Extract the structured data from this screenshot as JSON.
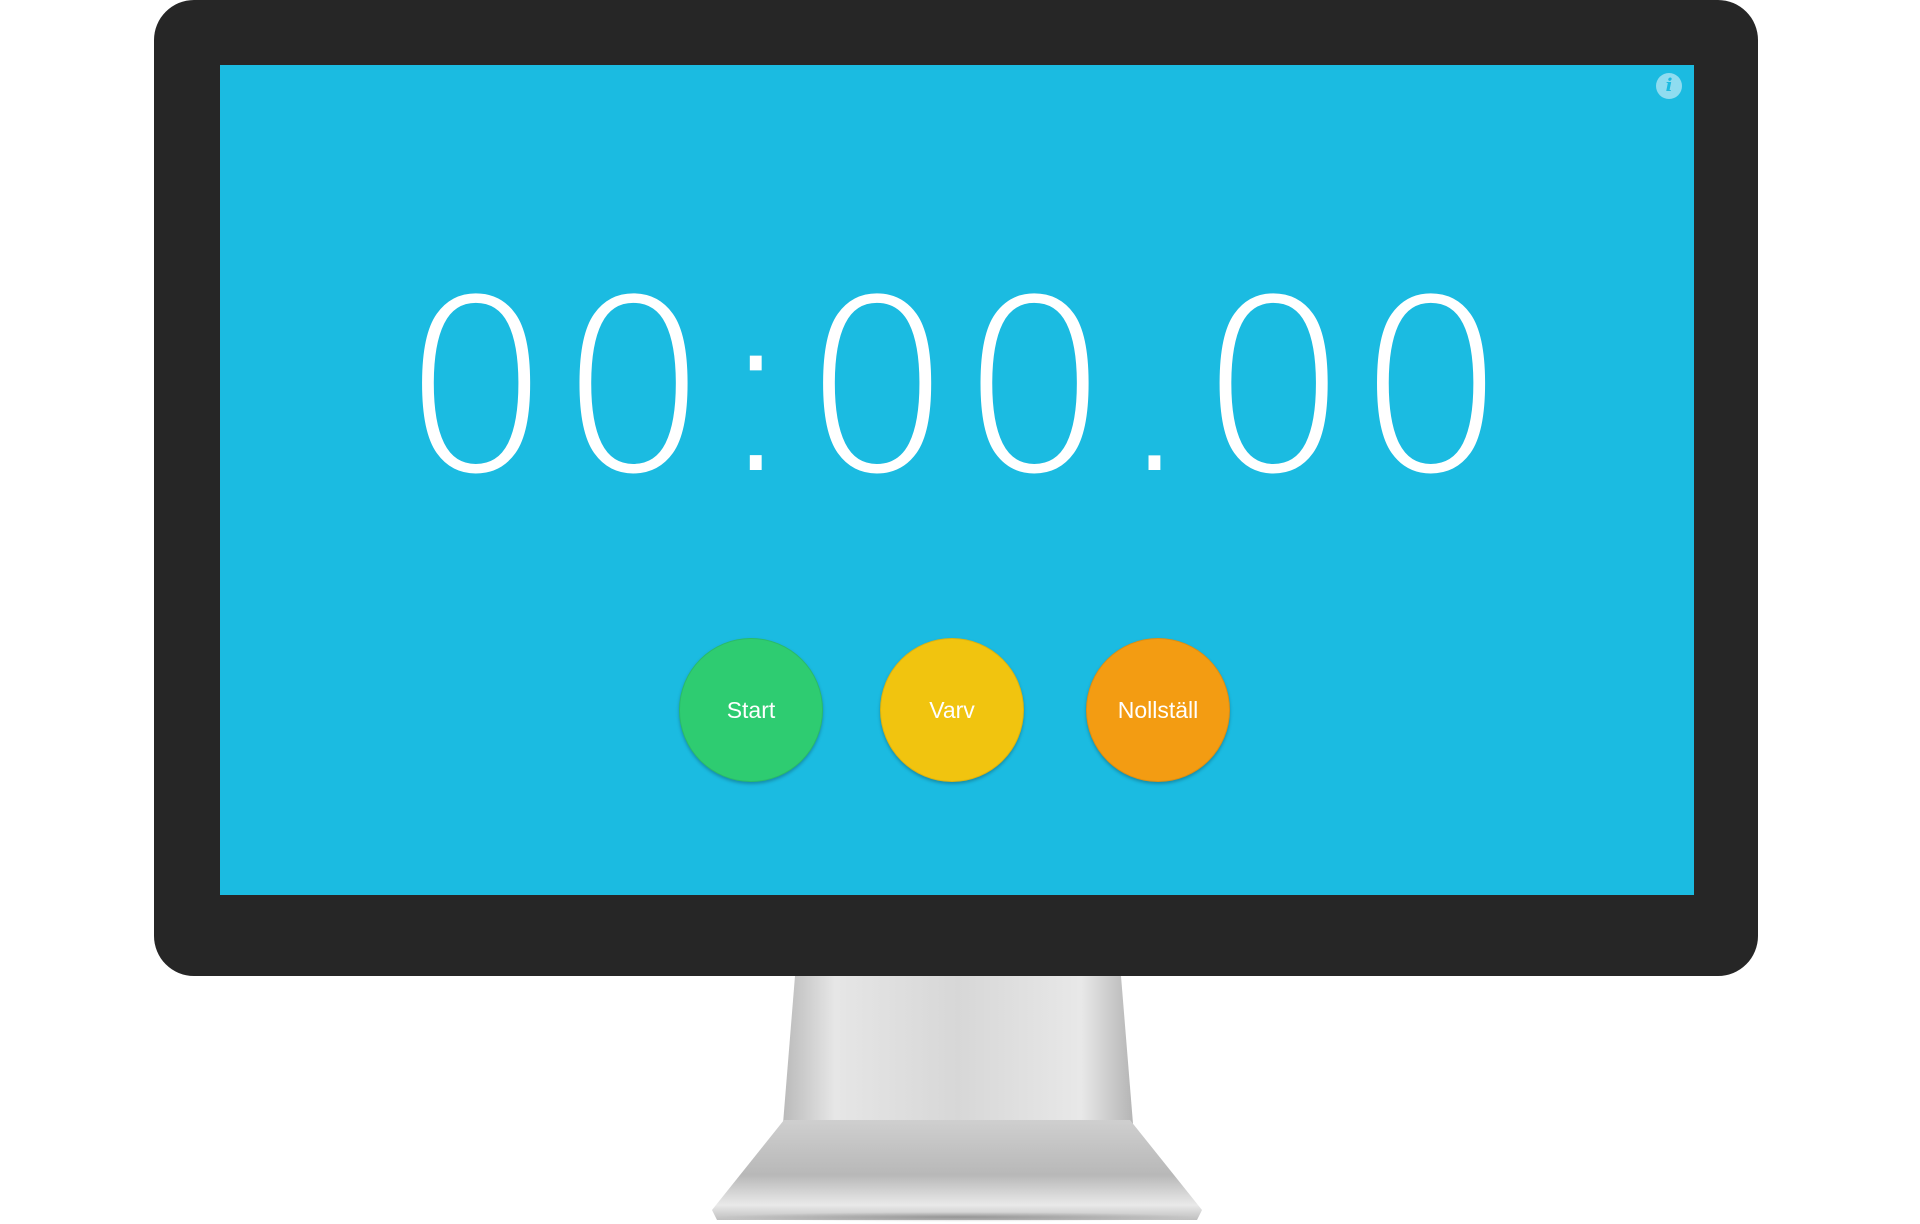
{
  "screen": {
    "background_color": "#1bbbe1",
    "info_icon": {
      "name": "info-icon",
      "glyph": "i"
    }
  },
  "stopwatch": {
    "display": "00:00.00"
  },
  "controls": {
    "start": {
      "label": "Start",
      "color": "#2ecc71"
    },
    "lap": {
      "label": "Varv",
      "color": "#f1c40f"
    },
    "reset": {
      "label": "Nollställ",
      "color": "#f39c12"
    }
  }
}
